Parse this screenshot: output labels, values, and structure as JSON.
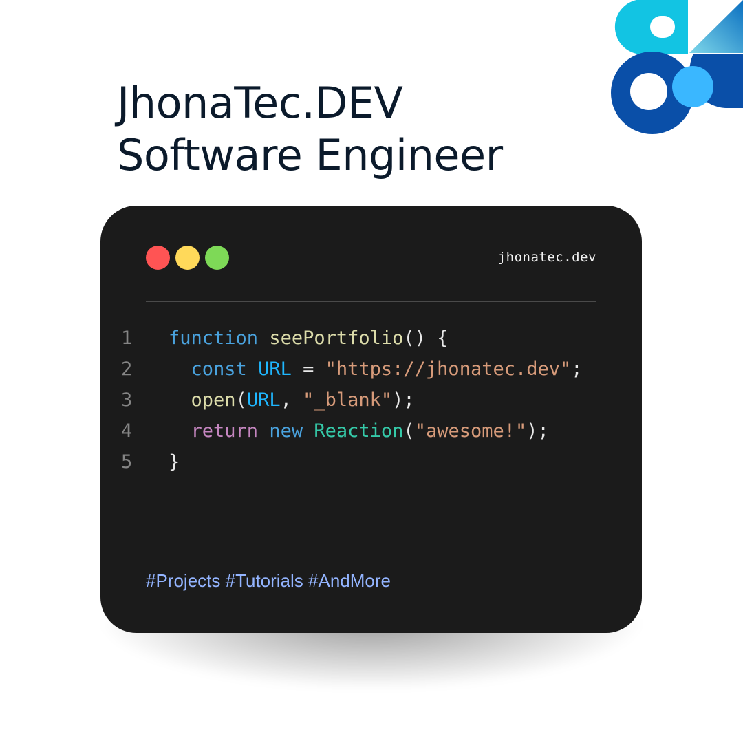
{
  "header": {
    "title_line1": "JhonaTec.DEV",
    "title_line2": "Software Engineer"
  },
  "logo": {
    "name": "brand-logo",
    "colors": {
      "cyan": "#12c4e3",
      "navy": "#0a4fa8",
      "light_blue": "#3ab7ff"
    }
  },
  "window": {
    "domain_label": "jhonatec.dev",
    "buttons": {
      "close_color": "#ff5454",
      "minimize_color": "#ffd95a",
      "maximize_color": "#7ed957"
    },
    "background_color": "#1b1b1b"
  },
  "code": {
    "lines": [
      {
        "number": "1",
        "tokens": [
          {
            "t": "function",
            "c": "kw-blue"
          },
          {
            "t": " ",
            "c": "punc"
          },
          {
            "t": "seePortfolio",
            "c": "fn-yellow"
          },
          {
            "t": "() {",
            "c": "punc"
          }
        ]
      },
      {
        "number": "2",
        "tokens": [
          {
            "t": "  ",
            "c": "punc"
          },
          {
            "t": "const",
            "c": "kw-blue"
          },
          {
            "t": " ",
            "c": "punc"
          },
          {
            "t": "URL",
            "c": "var-cyan"
          },
          {
            "t": " = ",
            "c": "punc"
          },
          {
            "t": "\"https://jhonatec.dev\"",
            "c": "str"
          },
          {
            "t": ";",
            "c": "punc"
          }
        ]
      },
      {
        "number": "3",
        "tokens": [
          {
            "t": "  ",
            "c": "punc"
          },
          {
            "t": "open",
            "c": "fn-yellow"
          },
          {
            "t": "(",
            "c": "punc"
          },
          {
            "t": "URL",
            "c": "var-cyan"
          },
          {
            "t": ", ",
            "c": "punc"
          },
          {
            "t": "\"_blank\"",
            "c": "str"
          },
          {
            "t": ");",
            "c": "punc"
          }
        ]
      },
      {
        "number": "4",
        "tokens": [
          {
            "t": "  ",
            "c": "punc"
          },
          {
            "t": "return",
            "c": "kw-purple"
          },
          {
            "t": " ",
            "c": "punc"
          },
          {
            "t": "new",
            "c": "kw-blue"
          },
          {
            "t": " ",
            "c": "punc"
          },
          {
            "t": "Reaction",
            "c": "cls"
          },
          {
            "t": "(",
            "c": "punc"
          },
          {
            "t": "\"awesome!\"",
            "c": "str"
          },
          {
            "t": ");",
            "c": "punc"
          }
        ]
      },
      {
        "number": "5",
        "tokens": [
          {
            "t": "}",
            "c": "punc"
          }
        ]
      }
    ]
  },
  "footer": {
    "hashtags": "#Projects #Tutorials #AndMore"
  }
}
